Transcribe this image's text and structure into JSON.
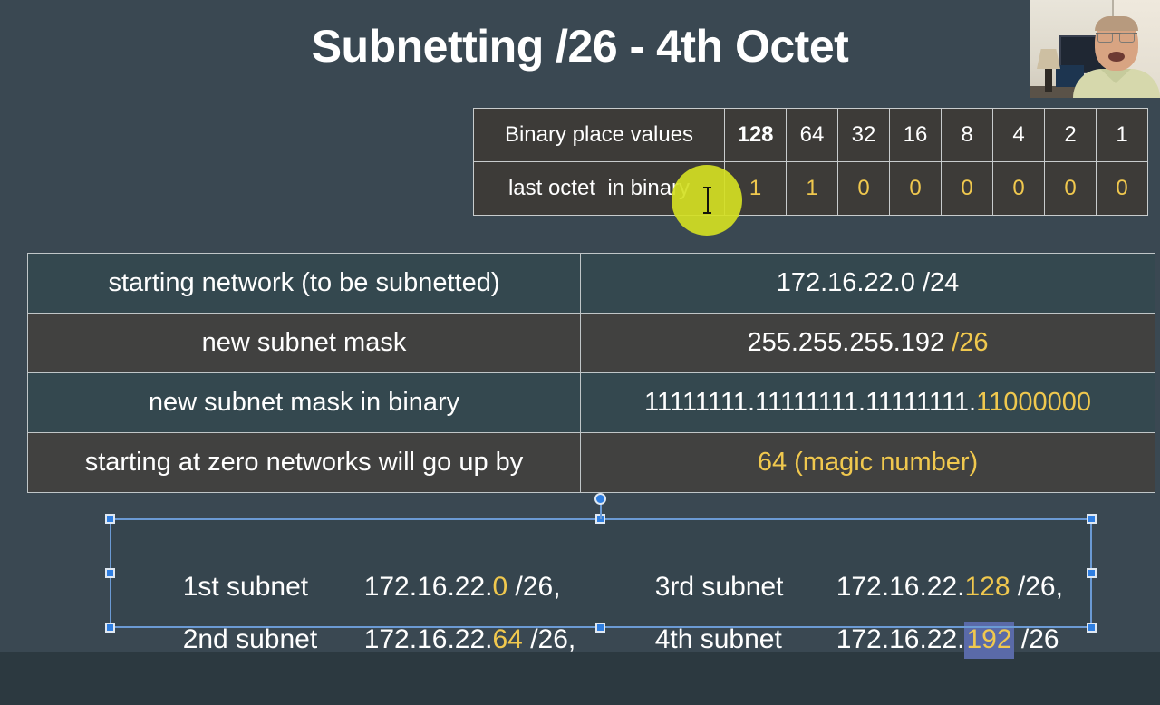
{
  "slide": {
    "title": "Subnetting /26 - 4th Octet",
    "background_color": "#3a4852",
    "accent_yellow": "#f0c84e"
  },
  "binary_table": {
    "rows": [
      {
        "label": "Binary place values",
        "cells": [
          "128",
          "64",
          "32",
          "16",
          "8",
          "4",
          "2",
          "1"
        ]
      },
      {
        "label": "last octet  in binary",
        "cells": [
          "1",
          "1",
          "0",
          "0",
          "0",
          "0",
          "0",
          "0"
        ]
      }
    ]
  },
  "info_table": {
    "rows": [
      {
        "label": "starting network (to be subnetted)",
        "value_white": "172.16.22.0 /24",
        "value_yellow": ""
      },
      {
        "label": "new subnet mask",
        "value_white": "255.255.255.192 ",
        "value_yellow": "/26"
      },
      {
        "label": "new subnet mask in binary",
        "value_white": "11111111.11111111.11111111.",
        "value_yellow": "11000000"
      },
      {
        "label": "starting at zero networks will go up by",
        "value_white": "",
        "value_yellow": "64 (magic number)"
      }
    ]
  },
  "subnets": {
    "first": {
      "label": "1st subnet",
      "prefix": "172.16.22.",
      "octet": "0",
      "suffix": " /26,"
    },
    "second": {
      "label": "2nd subnet",
      "prefix": "172.16.22.",
      "octet": "64",
      "suffix": " /26,"
    },
    "third": {
      "label": "3rd subnet",
      "prefix": "172.16.22.",
      "octet": "128",
      "suffix": " /26,"
    },
    "fourth": {
      "label": "4th subnet",
      "prefix": "172.16.22.",
      "octet": "192",
      "suffix": " /26"
    }
  },
  "selection": {
    "highlight_color": "#5a6aa8",
    "frame_color": "#6b9ad4",
    "selected_text": "192"
  },
  "cursor": {
    "click_highlight_color": "#d4e023",
    "icon": "i-beam-text-cursor"
  }
}
